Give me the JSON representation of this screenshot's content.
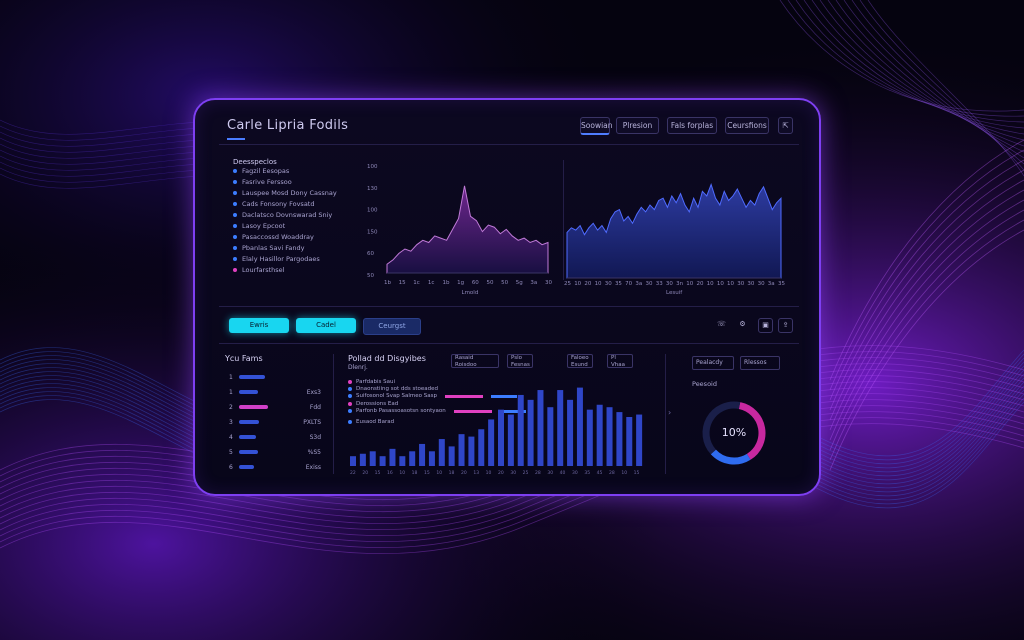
{
  "colors": {
    "accent": "#7e3ff2",
    "blue": "#3c7dff",
    "cyan": "#18d6f0",
    "pink": "#e040c0"
  },
  "header": {
    "title": "Carle Lipria Fodils",
    "buttons": [
      "Soowian",
      "Plresion",
      "Fals forplas",
      "Ceursfions"
    ],
    "expand_icon": "expand-icon"
  },
  "sidebar": {
    "heading1": "Deesspeclos",
    "heading2": "Fagzil Eesopas",
    "items": [
      {
        "label": "Fasrive Ferssoo"
      },
      {
        "label": "Lauspee Mosd Dony Cassnay"
      },
      {
        "label": "Cads Fonsony Fovsatd"
      },
      {
        "label": "Daclatsco Dovnswarad Sniy"
      },
      {
        "label": "Lasoy Epcoot"
      },
      {
        "label": "Pasaccossd Woaddray"
      },
      {
        "label": "Pbanlas Savi Fandy"
      },
      {
        "label": "Elaly Hasillor Pargodaes"
      },
      {
        "label": "Lourfarsthsel"
      }
    ]
  },
  "chart_left": {
    "yticks": [
      "100",
      "130",
      "100",
      "150",
      "60",
      "50"
    ],
    "xticks": [
      "1b",
      "15",
      "1c",
      "1c",
      "1b",
      "1g",
      "60",
      "50",
      "50",
      "5g",
      "3a",
      "30"
    ],
    "xlabel": "Lmold"
  },
  "chart_right": {
    "xticks": [
      "25",
      "10",
      "20",
      "10",
      "30",
      "35",
      "70",
      "3a",
      "30",
      "33",
      "30",
      "3n",
      "10",
      "20",
      "10",
      "10",
      "10",
      "30",
      "30",
      "30",
      "3a",
      "35"
    ],
    "xlabel": "Lesuif"
  },
  "actions": {
    "btn1": "Ewris",
    "btn2": "Cadel",
    "btn3": "Ceurgst",
    "icons": [
      "phone-icon",
      "settings-icon",
      "image-icon",
      "share-icon"
    ]
  },
  "top_items": {
    "title": "Ycu Fams",
    "rows": [
      {
        "rank": "1",
        "value": "",
        "fill": 0.75
      },
      {
        "rank": "1",
        "value": "Exs3",
        "fill": 0.55
      },
      {
        "rank": "2",
        "value": "Fdd",
        "fill": 0.85
      },
      {
        "rank": "3",
        "value": "PXLTS",
        "fill": 0.6
      },
      {
        "rank": "4",
        "value": "S3d",
        "fill": 0.5
      },
      {
        "rank": "5",
        "value": "%S5",
        "fill": 0.55
      },
      {
        "rank": "6",
        "value": "Exiss",
        "fill": 0.45
      }
    ]
  },
  "middle": {
    "title": "Pollad dd Disgyibes",
    "subtitle": "Dlenrj.",
    "boxes": [
      "Rasaid Roisdoo Fesnas",
      "Pslo Fesnas",
      "Faloeo Esund",
      "Pl Vhaa"
    ],
    "legend": [
      {
        "label": "Parfdabis Saui",
        "color": "#e040c0"
      },
      {
        "label": "Dnaonstiing sot dds stoeaded",
        "color": "#3c7dff"
      },
      {
        "label": "Suifosonol Svap Salmeo Sasp",
        "color": "#3c7dff"
      },
      {
        "label": "Derossions Ead",
        "color": "#e040c0"
      },
      {
        "label": "Parfonb Pasassoasotsn sontyaon",
        "color": "#3c7dff"
      },
      {
        "label": "Eusaod Barad",
        "color": "#3c7dff"
      }
    ],
    "bar_labels": [
      "22",
      "20",
      "15",
      "16",
      "10",
      "18",
      "15",
      "10",
      "18",
      "20",
      "13",
      "10",
      "20",
      "30",
      "25",
      "28",
      "30",
      "40",
      "30",
      "35",
      "45",
      "28",
      "10",
      "15"
    ]
  },
  "right": {
    "tabs": [
      "Pealacdy",
      "Rlessos"
    ],
    "label": "Peesoid",
    "gauge_value": "10%"
  },
  "chart_data": [
    {
      "type": "area",
      "name": "left-area",
      "values": [
        8,
        12,
        18,
        22,
        20,
        26,
        30,
        28,
        34,
        32,
        30,
        40,
        50,
        80,
        52,
        48,
        38,
        44,
        42,
        36,
        40,
        34,
        30,
        32,
        28,
        30,
        26,
        28
      ],
      "ylim": [
        0,
        100
      ]
    },
    {
      "type": "area",
      "name": "right-area",
      "values": [
        40,
        44,
        42,
        46,
        38,
        44,
        48,
        42,
        46,
        40,
        52,
        58,
        60,
        50,
        54,
        48,
        56,
        62,
        58,
        64,
        60,
        68,
        70,
        62,
        72,
        66,
        74,
        64,
        58,
        70,
        62,
        76,
        72,
        82,
        70,
        64,
        76,
        68,
        72,
        78,
        70,
        62,
        68,
        64,
        74,
        80,
        70,
        60,
        66,
        70
      ],
      "ylim": [
        0,
        100
      ]
    },
    {
      "type": "bar",
      "name": "middle-bars",
      "values": [
        8,
        10,
        12,
        8,
        14,
        8,
        12,
        18,
        12,
        22,
        16,
        26,
        24,
        30,
        38,
        46,
        42,
        58,
        54,
        62,
        48,
        62,
        54,
        64,
        46,
        50,
        48,
        44,
        40,
        42
      ]
    },
    {
      "type": "pie",
      "name": "gauge",
      "values": [
        38,
        22,
        40
      ],
      "labels": [
        "magenta",
        "blue",
        "dark"
      ]
    }
  ]
}
